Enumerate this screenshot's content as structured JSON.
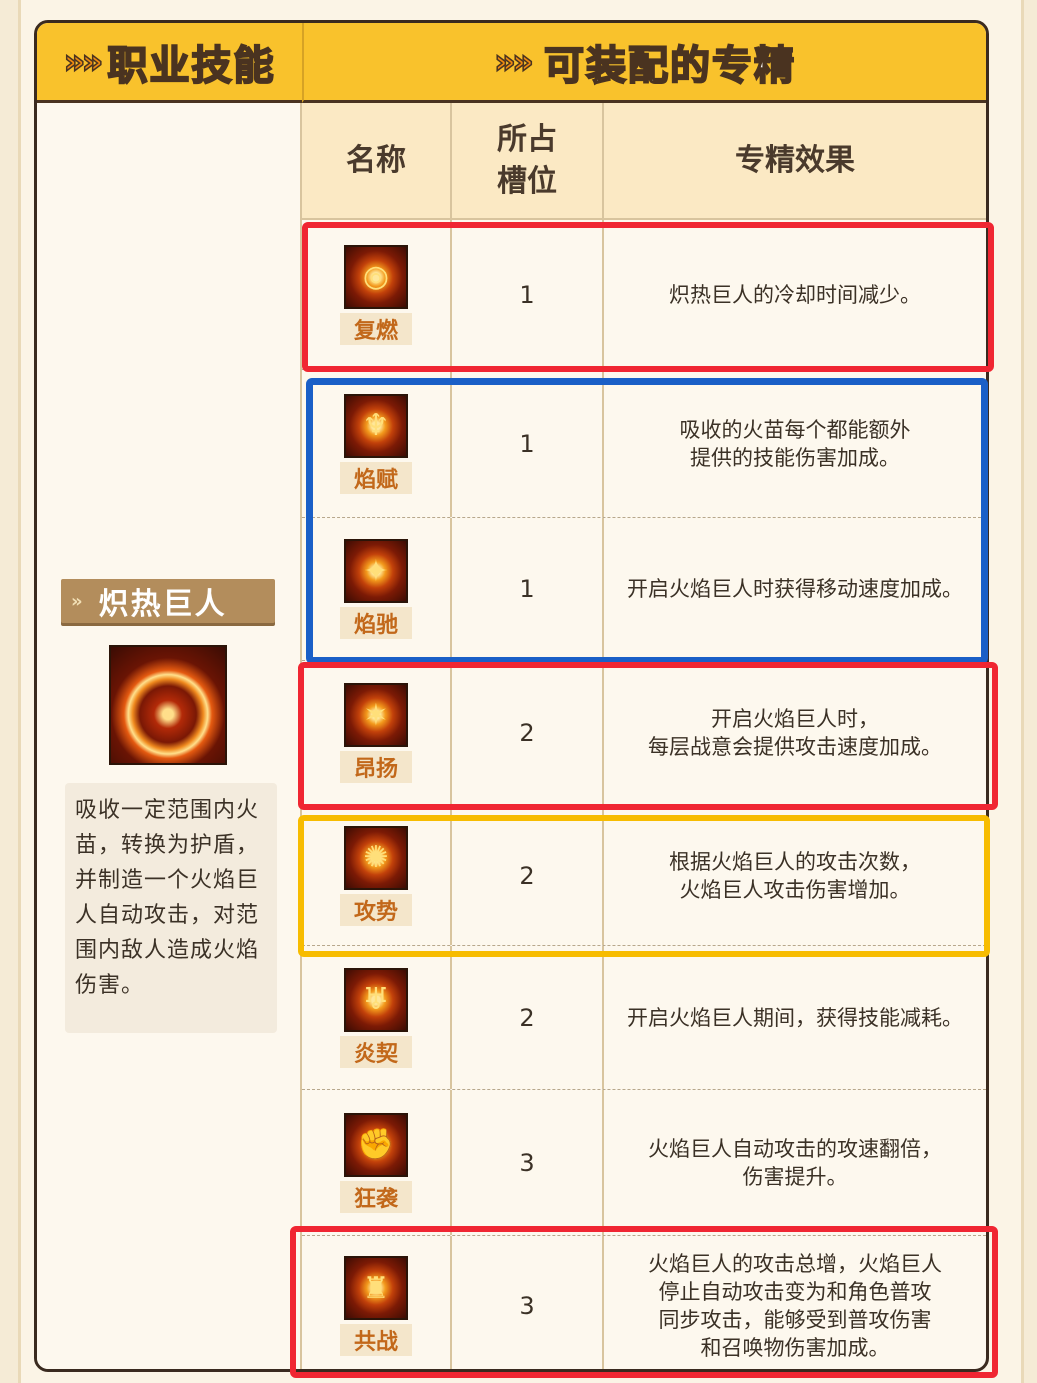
{
  "headers": {
    "left": "职业技能",
    "right": "可装配的专精",
    "chevron": "»"
  },
  "skill": {
    "name": "炽热巨人",
    "chevron": "»",
    "description": "吸收一定范围内火苗，转换为护盾，并制造一个火焰巨人自动攻击，对范围内敌人造成火焰伤害。"
  },
  "columns": {
    "name": "名称",
    "slot_line1": "所占",
    "slot_line2": "槽位",
    "effect": "专精效果"
  },
  "specs": [
    {
      "name": "复燃",
      "slot": "1",
      "effect": "炽热巨人的冷却时间减少。",
      "icon": "swirl-icon",
      "glyph": "◎"
    },
    {
      "name": "焰赋",
      "slot": "1",
      "effect": "吸收的火苗每个都能额外\n提供的技能伤害加成。",
      "icon": "figure-icon",
      "glyph": "♆"
    },
    {
      "name": "焰驰",
      "slot": "1",
      "effect": "开启火焰巨人时获得移动速度加成。",
      "icon": "boot-icon",
      "glyph": "✦"
    },
    {
      "name": "昂扬",
      "slot": "2",
      "effect": "开启火焰巨人时，\n每层战意会提供攻击速度加成。",
      "icon": "scroll-icon",
      "glyph": "✶"
    },
    {
      "name": "攻势",
      "slot": "2",
      "effect": "根据火焰巨人的攻击次数，\n火焰巨人攻击伤害增加。",
      "icon": "flame-ring-icon",
      "glyph": "✺"
    },
    {
      "name": "炎契",
      "slot": "2",
      "effect": "开启火焰巨人期间，获得技能减耗。",
      "icon": "demon-icon",
      "glyph": "♅"
    },
    {
      "name": "狂袭",
      "slot": "3",
      "effect": "火焰巨人自动攻击的攻速翻倍，\n伤害提升。",
      "icon": "fist-icon",
      "glyph": "✊"
    },
    {
      "name": "共战",
      "slot": "3",
      "effect": "火焰巨人的攻击总增，火焰巨人\n停止自动攻击变为和角色普攻\n同步攻击，能够受到普攻伤害\n和召唤物伤害加成。",
      "icon": "helmet-icon",
      "glyph": "♜"
    }
  ],
  "colors": {
    "header": "#f9c22c",
    "highlight_red": "#f02632",
    "highlight_blue": "#1a5fc7",
    "highlight_yellow": "#f7bc00"
  }
}
